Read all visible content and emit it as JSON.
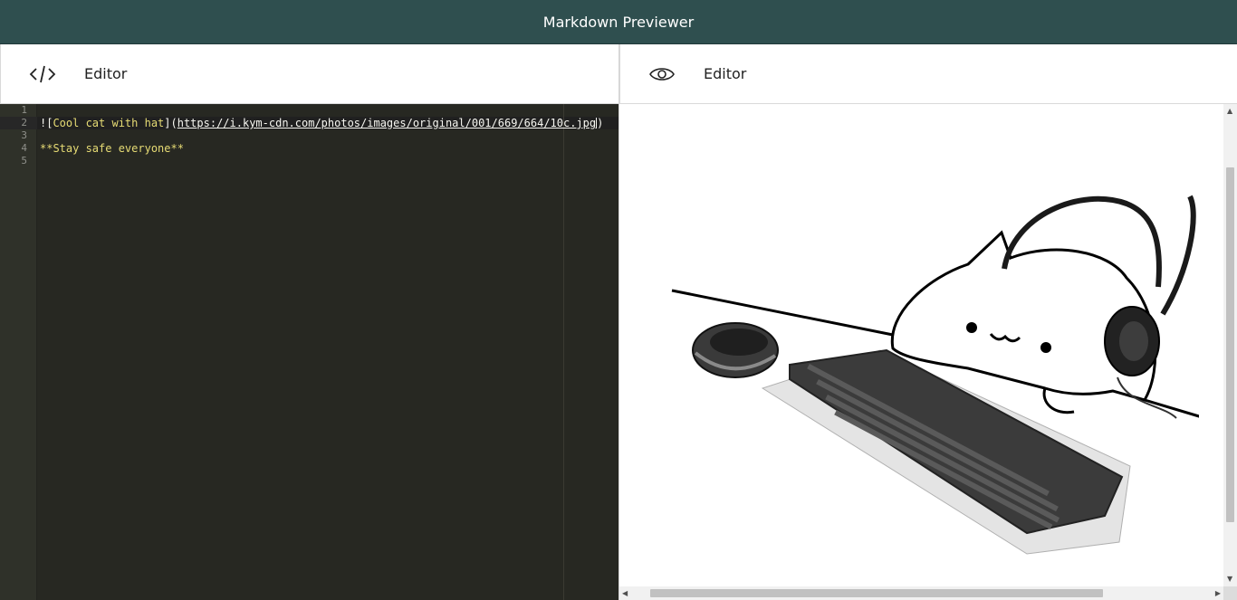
{
  "app": {
    "title": "Markdown Previewer"
  },
  "editor_pane": {
    "label": "Editor",
    "icon": "code-icon"
  },
  "preview_pane": {
    "label": "Editor",
    "icon": "eye-icon"
  },
  "editor": {
    "line_numbers": [
      "1",
      "2",
      "3",
      "4",
      "5"
    ],
    "lines": {
      "l2_prefix": "![",
      "l2_alt": "Cool cat with hat",
      "l2_mid": "](",
      "l2_url": "https://i.kym-cdn.com/photos/images/original/001/669/664/10c.jpg",
      "l2_end": ")",
      "l4": "**Stay safe everyone**"
    }
  },
  "preview": {
    "image_alt": "Cool cat with hat"
  }
}
